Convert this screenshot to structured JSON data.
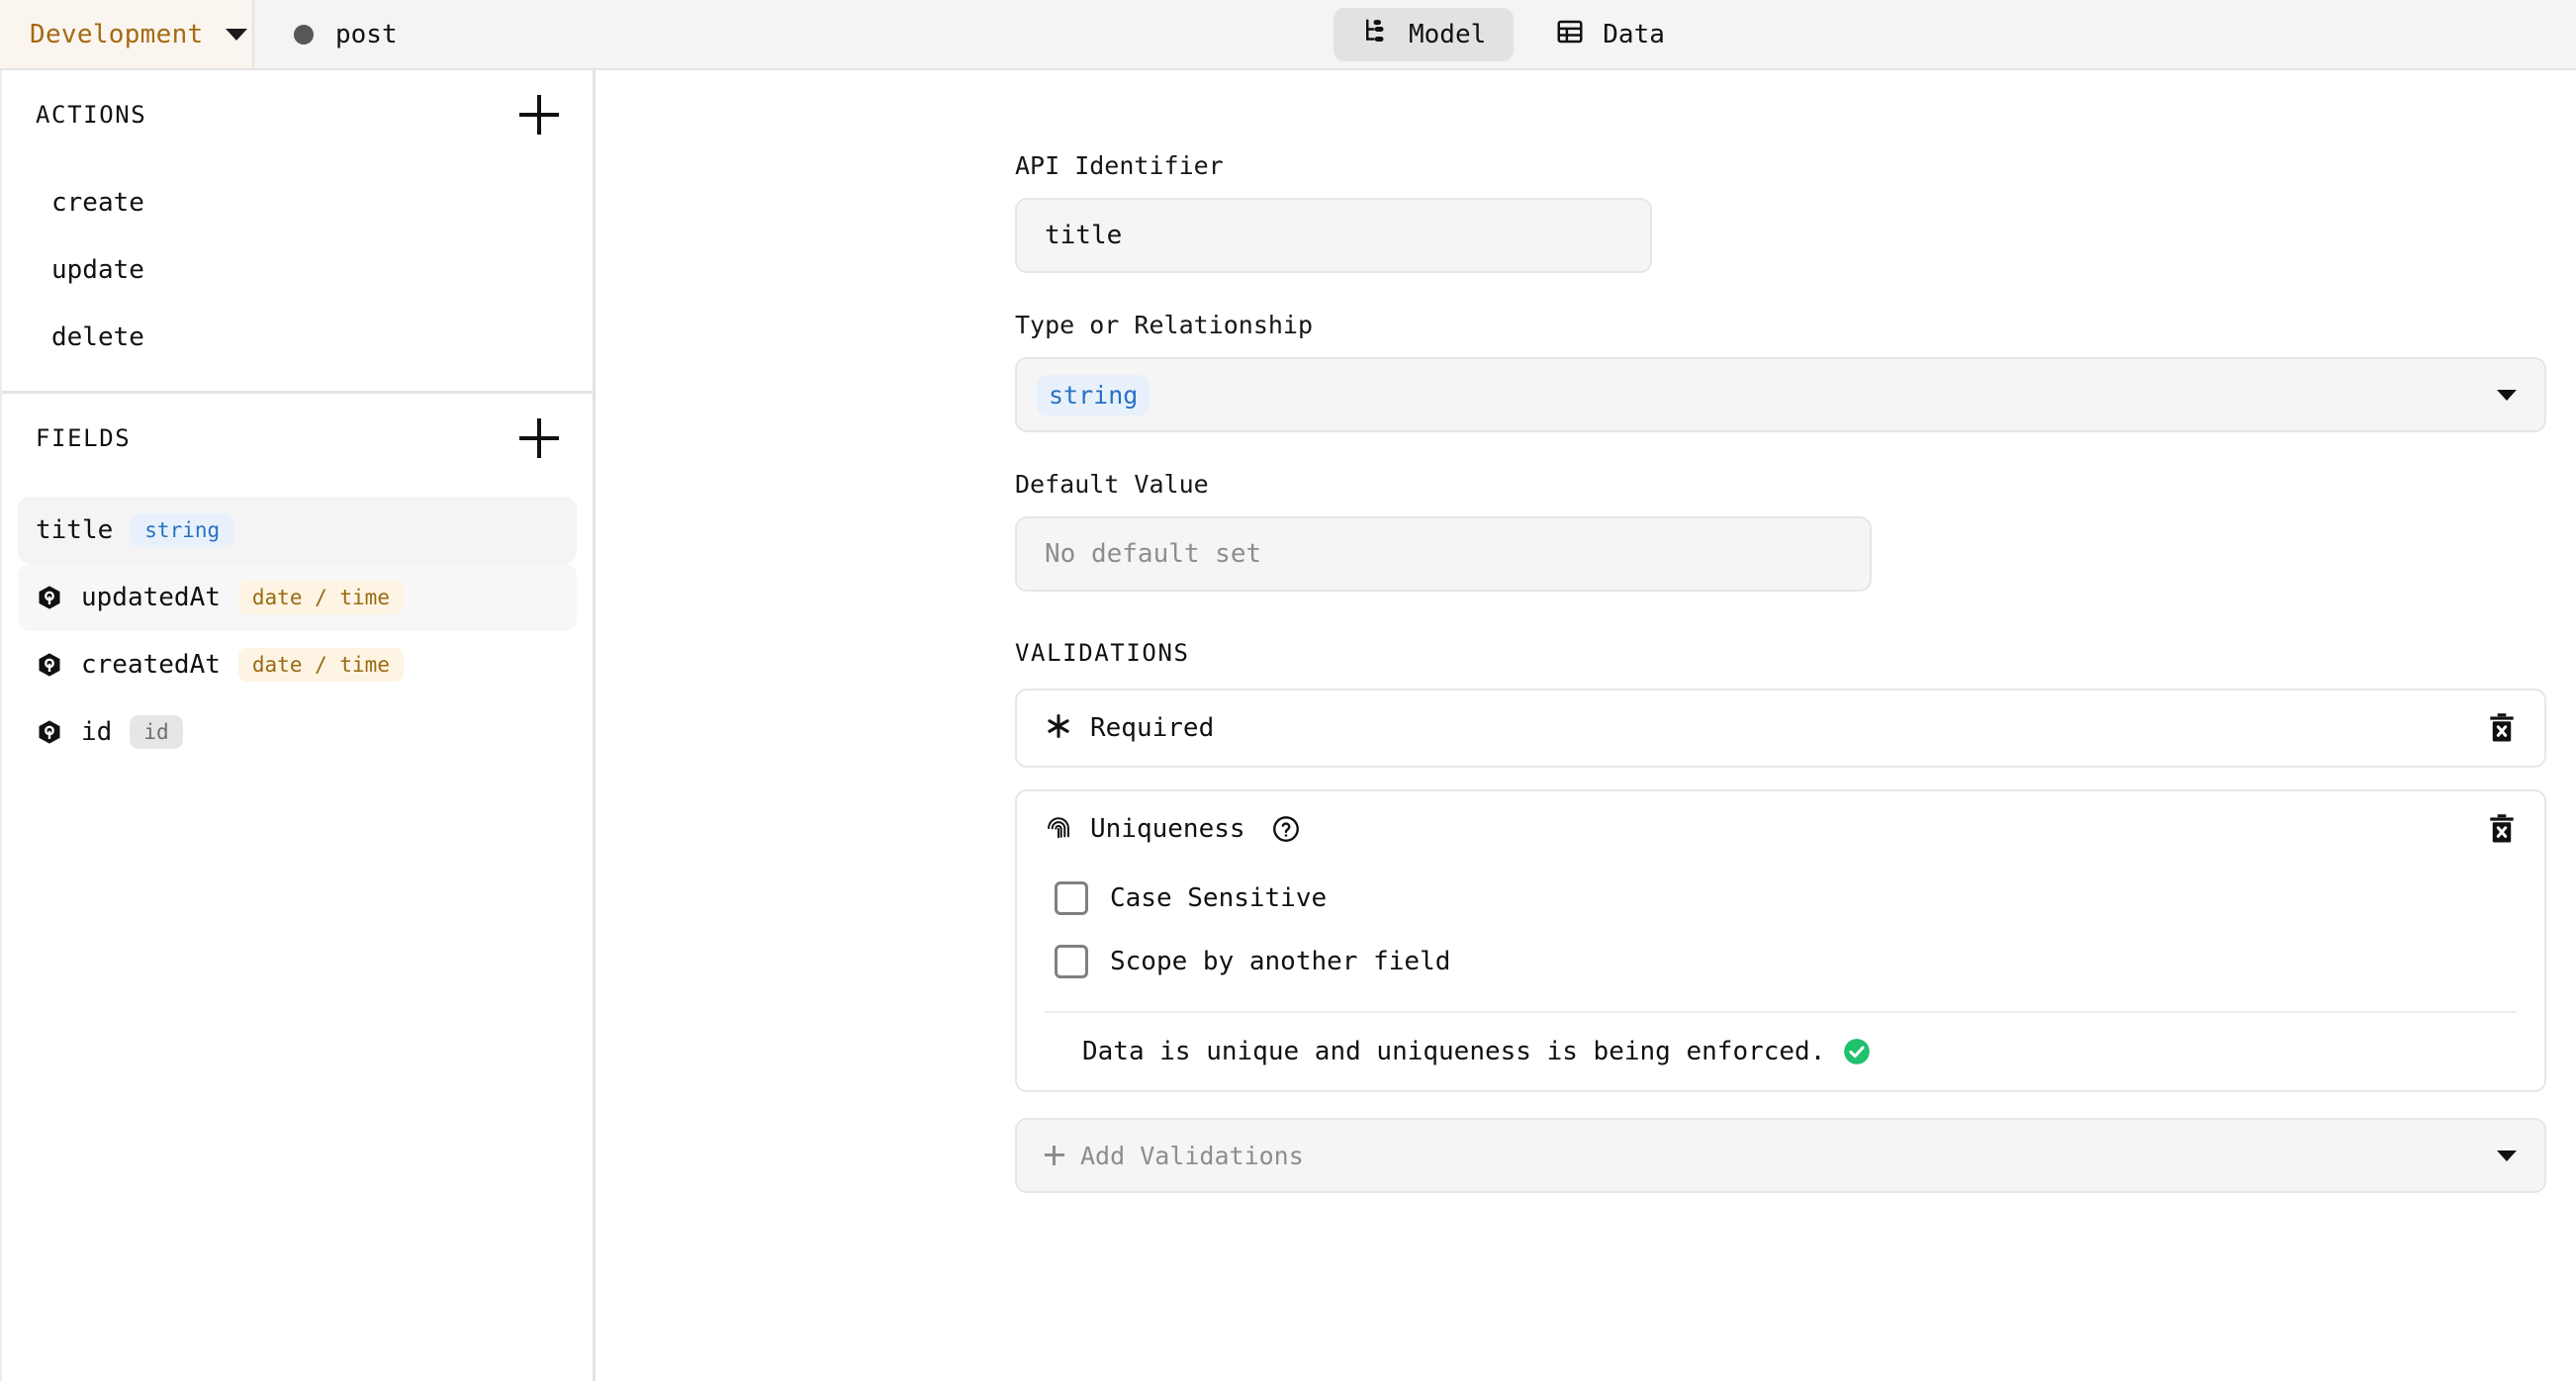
{
  "header": {
    "environment": "Development",
    "environment_caret": "chevron-down-icon",
    "model_name": "post",
    "model_status_dot": "status-dot-icon",
    "tabs": [
      {
        "label": "Model",
        "icon": "hierarchy-icon",
        "active": true
      },
      {
        "label": "Data",
        "icon": "table-icon",
        "active": false
      }
    ]
  },
  "sidebar": {
    "actions": {
      "title": "ACTIONS",
      "add_label": "plus-icon",
      "items": [
        {
          "label": "create"
        },
        {
          "label": "update"
        },
        {
          "label": "delete"
        }
      ]
    },
    "fields": {
      "title": "FIELDS",
      "add_label": "plus-icon",
      "items": [
        {
          "name": "title",
          "type": "string",
          "type_class": "type-string",
          "system": false,
          "state": "selected"
        },
        {
          "name": "updatedAt",
          "type": "date / time",
          "type_class": "type-datetime",
          "system": true,
          "state": "hover"
        },
        {
          "name": "createdAt",
          "type": "date / time",
          "type_class": "type-datetime",
          "system": true,
          "state": ""
        },
        {
          "name": "id",
          "type": "id",
          "type_class": "type-id",
          "system": true,
          "state": ""
        }
      ]
    }
  },
  "main": {
    "api_identifier": {
      "label": "API Identifier",
      "value": "title"
    },
    "type_or_relationship": {
      "label": "Type or Relationship",
      "value": "string"
    },
    "default_value": {
      "label": "Default Value",
      "value": "",
      "placeholder": "No default set"
    },
    "validations": {
      "title": "VALIDATIONS",
      "required": {
        "name": "Required",
        "icon": "asterisk-icon",
        "delete_icon": "trash-icon"
      },
      "uniqueness": {
        "name": "Uniqueness",
        "icon": "fingerprint-icon",
        "help_icon": "help-circle-icon",
        "delete_icon": "trash-icon",
        "options": [
          {
            "label": "Case Sensitive",
            "checked": false
          },
          {
            "label": "Scope by another field",
            "checked": false
          }
        ],
        "status_text": "Data is unique and uniqueness is being enforced.",
        "status_icon": "check-circle-icon"
      },
      "add": {
        "label": "Add Validations",
        "plus_icon": "plus-icon",
        "caret_icon": "chevron-down-icon"
      }
    }
  },
  "colors": {
    "env_accent": "#a56a12",
    "env_bg": "#faf5ef",
    "header_bg": "#f4f4f4",
    "tab_active_bg": "#e2e2e2",
    "type_string_bg": "#e8f1fb",
    "type_string_fg": "#2672c4",
    "type_datetime_bg": "#fdf4e3",
    "type_datetime_fg": "#9a6a12",
    "type_id_bg": "#e6e6e6",
    "type_id_fg": "#6d6d6d",
    "success_green": "#1fc16b",
    "placeholder_gray": "#8d8d8d"
  }
}
